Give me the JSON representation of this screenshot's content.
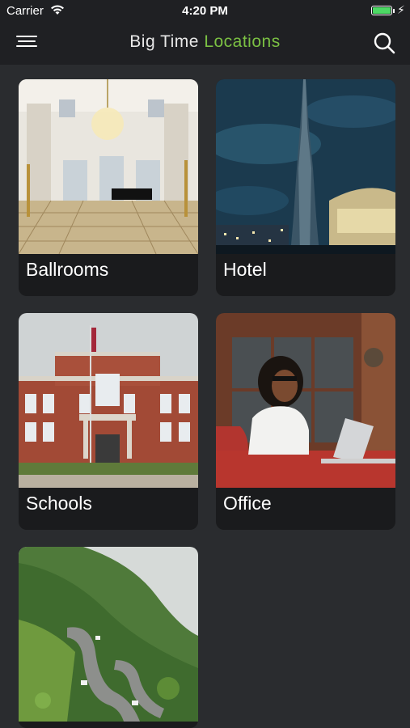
{
  "status_bar": {
    "carrier": "Carrier",
    "time": "4:20 PM"
  },
  "header": {
    "title_part1": "Big Time",
    "title_part2": "Locations",
    "accent_color": "#7bc043"
  },
  "icons": {
    "menu": "hamburger-menu-icon",
    "search": "search-icon"
  },
  "locations": [
    {
      "label": "Ballrooms",
      "image": "ballroom-photo"
    },
    {
      "label": "Hotel",
      "image": "skyline-photo"
    },
    {
      "label": "Schools",
      "image": "school-building-photo"
    },
    {
      "label": "Office",
      "image": "office-woman-laptop-photo"
    },
    {
      "label": "",
      "image": "mountain-road-photo"
    }
  ]
}
